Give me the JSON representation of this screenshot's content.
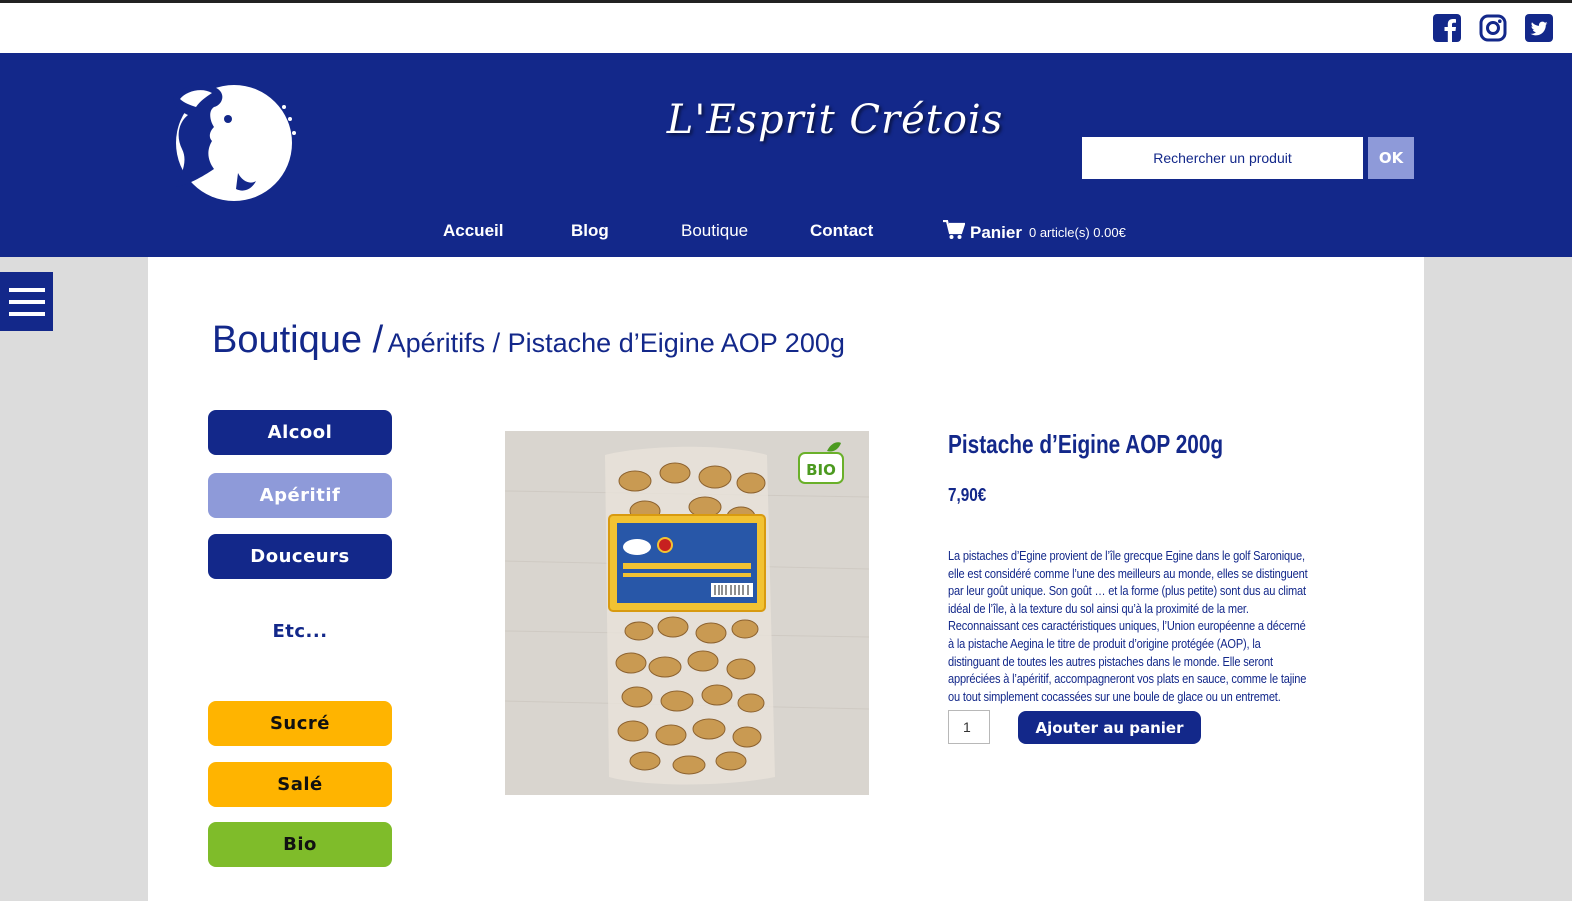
{
  "site": {
    "title": "L'Esprit Crétois",
    "logo_icon": "bull-woman-logo",
    "brand_color": "#13288a",
    "accent_color": "#8e9ad9"
  },
  "social": [
    {
      "name": "facebook",
      "icon": "facebook-icon"
    },
    {
      "name": "instagram",
      "icon": "instagram-icon"
    },
    {
      "name": "twitter",
      "icon": "twitter-icon"
    }
  ],
  "search": {
    "placeholder": "Rechercher un produit",
    "button_label": "OK"
  },
  "nav": {
    "items": [
      {
        "label": "Accueil"
      },
      {
        "label": "Blog"
      },
      {
        "label": "Boutique",
        "active": true
      },
      {
        "label": "Contact"
      }
    ],
    "cart": {
      "label": "Panier",
      "info": "0 article(s) 0.00€",
      "icon": "cart-icon"
    }
  },
  "breadcrumb": {
    "root": "Boutique /",
    "rest": "Apéritifs / Pistache d’Eigine AOP 200g"
  },
  "categories": [
    {
      "label": "Alcool",
      "style": "navy"
    },
    {
      "label": "Apéritif",
      "style": "lilac",
      "selected": true
    },
    {
      "label": "Douceurs",
      "style": "navy"
    },
    {
      "label": "Etc...",
      "style": "plain"
    },
    {
      "label": "Sucré",
      "style": "yellow"
    },
    {
      "label": "Salé",
      "style": "yellow"
    },
    {
      "label": "Bio",
      "style": "green"
    }
  ],
  "product": {
    "title": "Pistache d’Eigine AOP 200g",
    "price": "7,90€",
    "description": "La pistaches d’Egine provient de l’île grecque Egine dans le golf Saronique, elle est considéré comme l’une des meilleurs  au monde, elles se distinguent par leur goût unique. Son goût … et la forme (plus petite) sont dus au climat idéal de l’île, à la texture du sol ainsi qu’à la proximité de la mer. Reconnaissant ces caractéristiques uniques, l’Union européenne a décerné à la pistache Aegina le titre de produit d’origine protégée (AOP), la distinguant de toutes les autres pistaches dans le monde. Elle seront appréciées à l’apéritif,  accompagneront vos plats en sauce, comme le tajine ou tout simplement cocassées sur une boule de glace ou un entremet.",
    "quantity": "1",
    "add_button": "Ajouter au panier",
    "badge": "BIO"
  }
}
